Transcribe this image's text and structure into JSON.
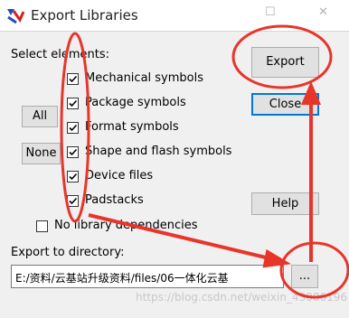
{
  "window": {
    "title": "Export Libraries",
    "minimize_glyph": "☐",
    "close_glyph": "✕"
  },
  "select_elements_label": "Select elements:",
  "buttons": {
    "all": "All",
    "none": "None",
    "export": "Export",
    "close": "Close",
    "help": "Help",
    "browse": "..."
  },
  "elements": [
    {
      "label": "Mechanical symbols",
      "checked": true
    },
    {
      "label": "Package symbols",
      "checked": true
    },
    {
      "label": "Format symbols",
      "checked": true
    },
    {
      "label": "Shape and flash symbols",
      "checked": true
    },
    {
      "label": "Device files",
      "checked": true
    },
    {
      "label": "Padstacks",
      "checked": true
    }
  ],
  "no_library_dependencies": {
    "label": "No library dependencies",
    "checked": false
  },
  "export_dir": {
    "label": "Export to directory:",
    "value": "E:/资料/云基站升级资料/files/06一体化云基"
  },
  "watermark": "https://blog.csdn.net/weixin_43086196",
  "colors": {
    "annotation_red": "#e8352a",
    "focus_blue": "#0078d7"
  }
}
